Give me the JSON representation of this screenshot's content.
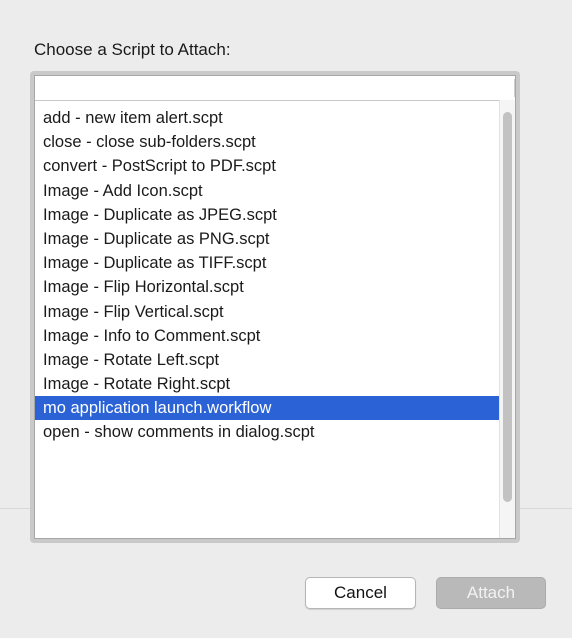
{
  "dialog": {
    "prompt": "Choose a Script to Attach:",
    "cancel_label": "Cancel",
    "attach_label": "Attach"
  },
  "scripts": {
    "items": [
      "add - new item alert.scpt",
      "close - close sub-folders.scpt",
      "convert - PostScript to PDF.scpt",
      "Image - Add Icon.scpt",
      "Image - Duplicate as JPEG.scpt",
      "Image - Duplicate as PNG.scpt",
      "Image - Duplicate as TIFF.scpt",
      "Image - Flip Horizontal.scpt",
      "Image - Flip Vertical.scpt",
      "Image - Info to Comment.scpt",
      "Image - Rotate Left.scpt",
      "Image - Rotate Right.scpt",
      "mo application launch.workflow",
      "open - show comments in dialog.scpt"
    ],
    "selected_index": 12
  },
  "colors": {
    "selection": "#2b63d6",
    "background": "#ececec"
  }
}
